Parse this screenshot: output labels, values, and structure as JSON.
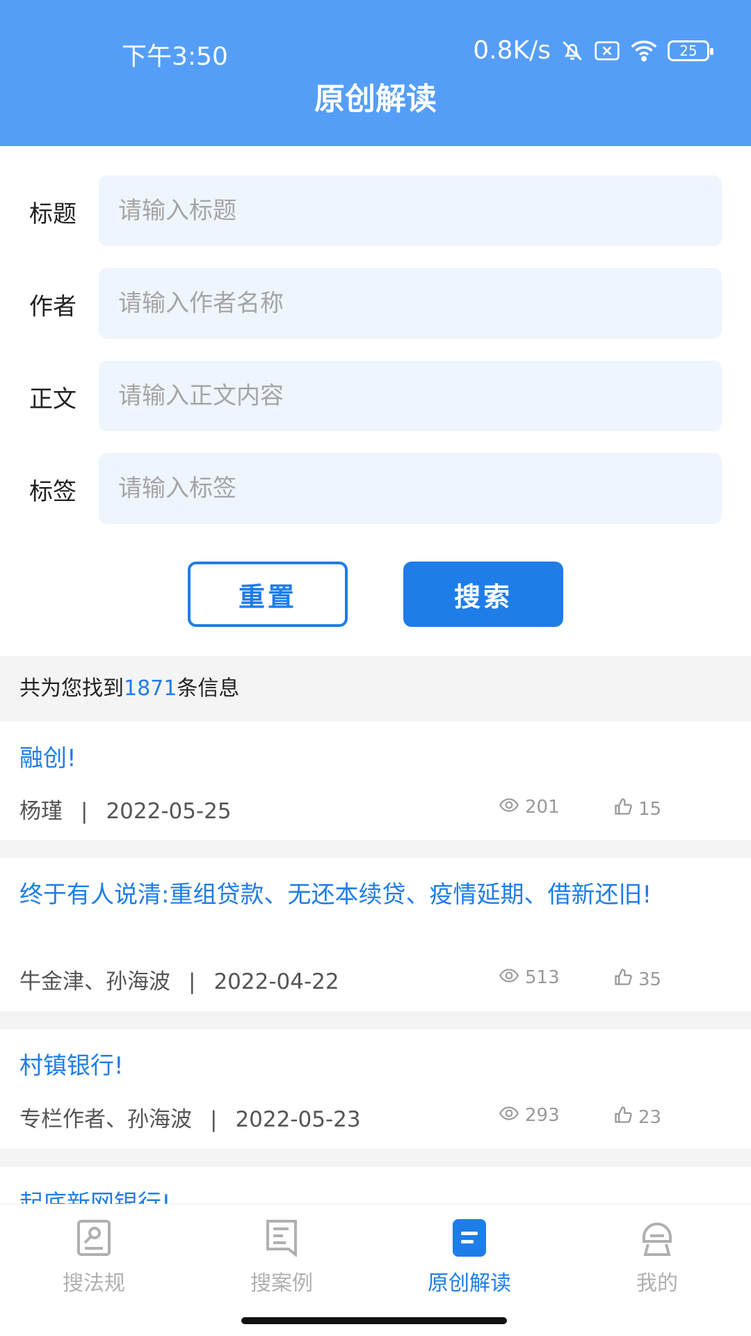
{
  "status": {
    "time": "下午3:50",
    "speed": "0.8K/s",
    "battery": "25"
  },
  "header": {
    "title": "原创解读"
  },
  "form": {
    "fields": [
      {
        "label": "标题",
        "placeholder": "请输入标题"
      },
      {
        "label": "作者",
        "placeholder": "请输入作者名称"
      },
      {
        "label": "正文",
        "placeholder": "请输入正文内容"
      },
      {
        "label": "标签",
        "placeholder": "请输入标签"
      }
    ],
    "reset_label": "重置",
    "search_label": "搜索"
  },
  "results": {
    "prefix": "共为您找到",
    "count": "1871",
    "suffix": "条信息"
  },
  "articles": [
    {
      "title": "融创!",
      "author": "杨瑾",
      "sep": "|",
      "date": "2022-05-25",
      "views": "201",
      "likes": "15"
    },
    {
      "title": "终于有人说清:重组贷款、无还本续贷、疫情延期、借新还旧!",
      "author": "牛金津、孙海波",
      "sep": "|",
      "date": "2022-04-22",
      "views": "513",
      "likes": "35"
    },
    {
      "title": "村镇银行!",
      "author": "专栏作者、孙海波",
      "sep": "|",
      "date": "2022-05-23",
      "views": "293",
      "likes": "23"
    },
    {
      "title": "起底新网银行!"
    }
  ],
  "tabbar": {
    "items": [
      {
        "label": "搜法规",
        "icon": "law-search-icon"
      },
      {
        "label": "搜案例",
        "icon": "case-search-icon"
      },
      {
        "label": "原创解读",
        "icon": "original-reading-icon"
      },
      {
        "label": "我的",
        "icon": "profile-icon"
      }
    ],
    "active_index": 2
  },
  "colors": {
    "header_bg": "#559ef8",
    "accent": "#1f7de8",
    "input_bg": "#eff5fd",
    "muted": "#999999"
  }
}
